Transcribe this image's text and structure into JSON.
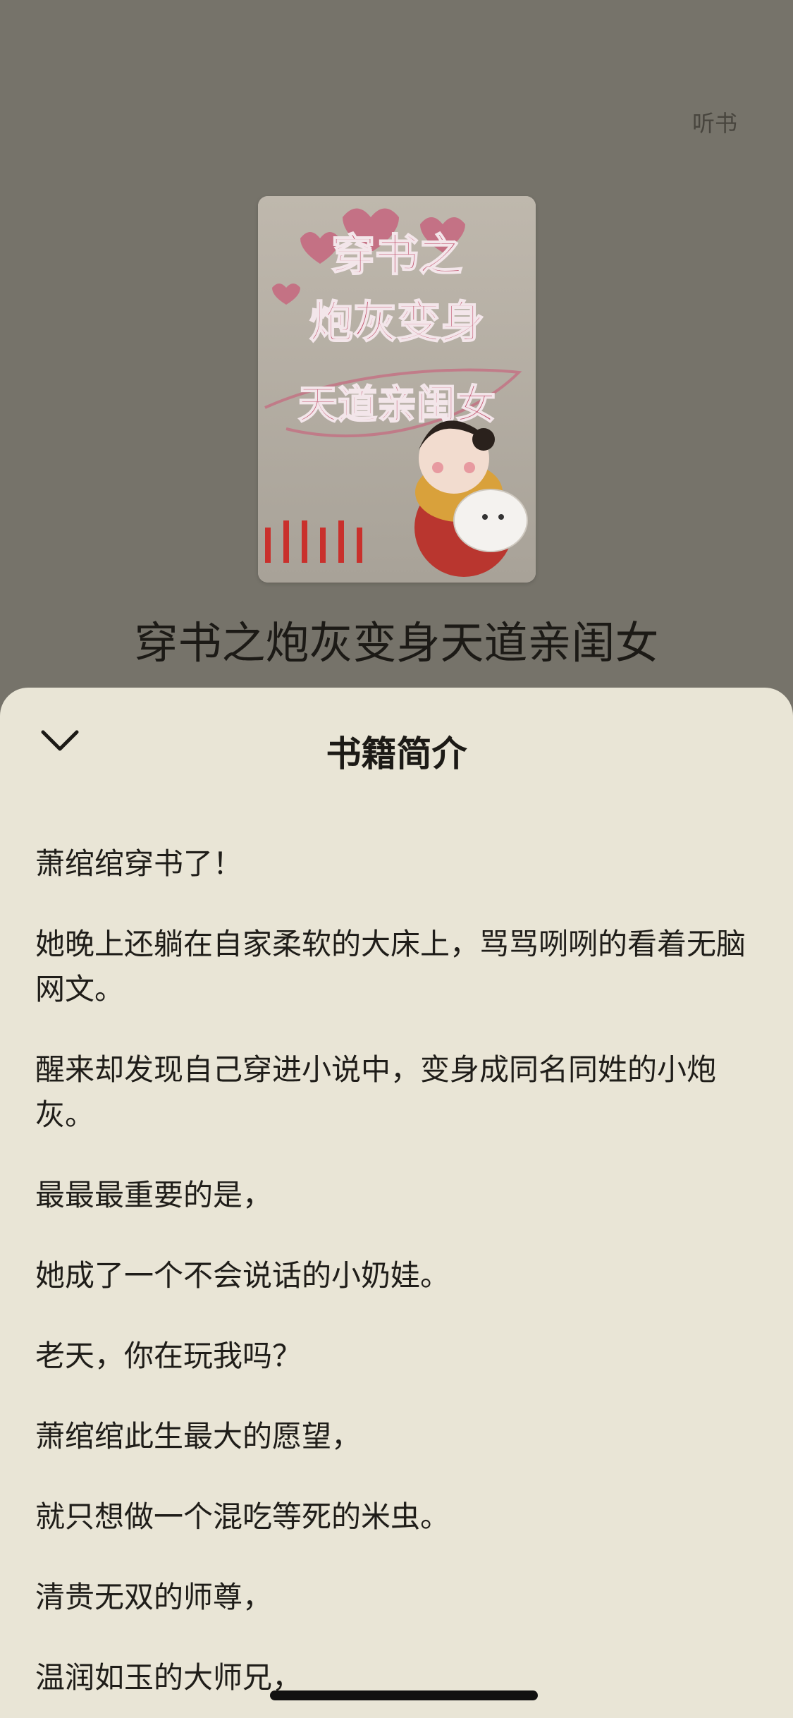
{
  "header": {
    "listen_label": "听书"
  },
  "book": {
    "title": "穿书之炮灰变身天道亲闺女",
    "cover": {
      "line1": "穿书之",
      "line2": "炮灰变身",
      "line3": "天道亲闺女"
    }
  },
  "sheet": {
    "title": "书籍简介",
    "paragraphs": [
      "萧绾绾穿书了！",
      "她晚上还躺在自家柔软的大床上，骂骂咧咧的看着无脑网文。",
      "醒来却发现自己穿进小说中，变身成同名同姓的小炮灰。",
      "最最最重要的是，",
      "她成了一个不会说话的小奶娃。",
      "老天，你在玩我吗？",
      "萧绾绾此生最大的愿望，",
      "就只想做一个混吃等死的米虫。",
      "清贵无双的师尊，",
      "温润如玉的大师兄，"
    ]
  },
  "colors": {
    "backdrop": "#76736a",
    "sheet": "#e9e5d6",
    "text": "#1f1d19"
  }
}
